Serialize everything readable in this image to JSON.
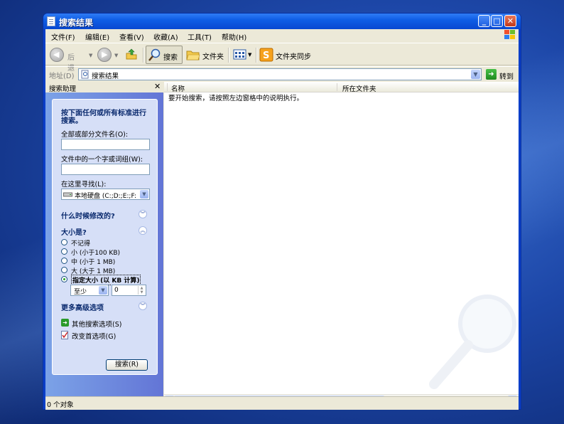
{
  "window": {
    "title": "搜索结果"
  },
  "menu": [
    "文件(F)",
    "编辑(E)",
    "查看(V)",
    "收藏(A)",
    "工具(T)",
    "帮助(H)"
  ],
  "toolbar": {
    "back": "后退",
    "search": "搜索",
    "folders": "文件夹",
    "sync": "文件夹同步"
  },
  "address": {
    "label": "地址(D)",
    "value": "搜索结果",
    "go": "转到"
  },
  "search_pane": {
    "title": "搜索助理",
    "heading": "按下面任何或所有标准进行搜索。",
    "filename_label": "全部或部分文件名(O):",
    "filename_value": "",
    "word_label": "文件中的一个字或词组(W):",
    "word_value": "",
    "look_in_label": "在这里寻找(L):",
    "look_in_value": "本地硬盘 (C:;D:;E:;F:",
    "when_modified": "什么时候修改的?",
    "size_heading": "大小是?",
    "size_options": [
      "不记得",
      "小 (小于100 KB)",
      "中 (小于 1 MB)",
      "大 (大于 1 MB)",
      "指定大小 (以 KB 计算)"
    ],
    "size_selected_index": 4,
    "size_qualifier": "至少",
    "size_value": "0",
    "advanced": "更多高级选项",
    "other_options": "其他搜索选项(S)",
    "change_prefs": "改变首选项(G)",
    "search_button": "搜索(R)"
  },
  "results": {
    "columns": [
      "名称",
      "所在文件夹"
    ],
    "message": "要开始搜索，请按照左边窗格中的说明执行。"
  },
  "status": {
    "text": "0 个对象"
  }
}
